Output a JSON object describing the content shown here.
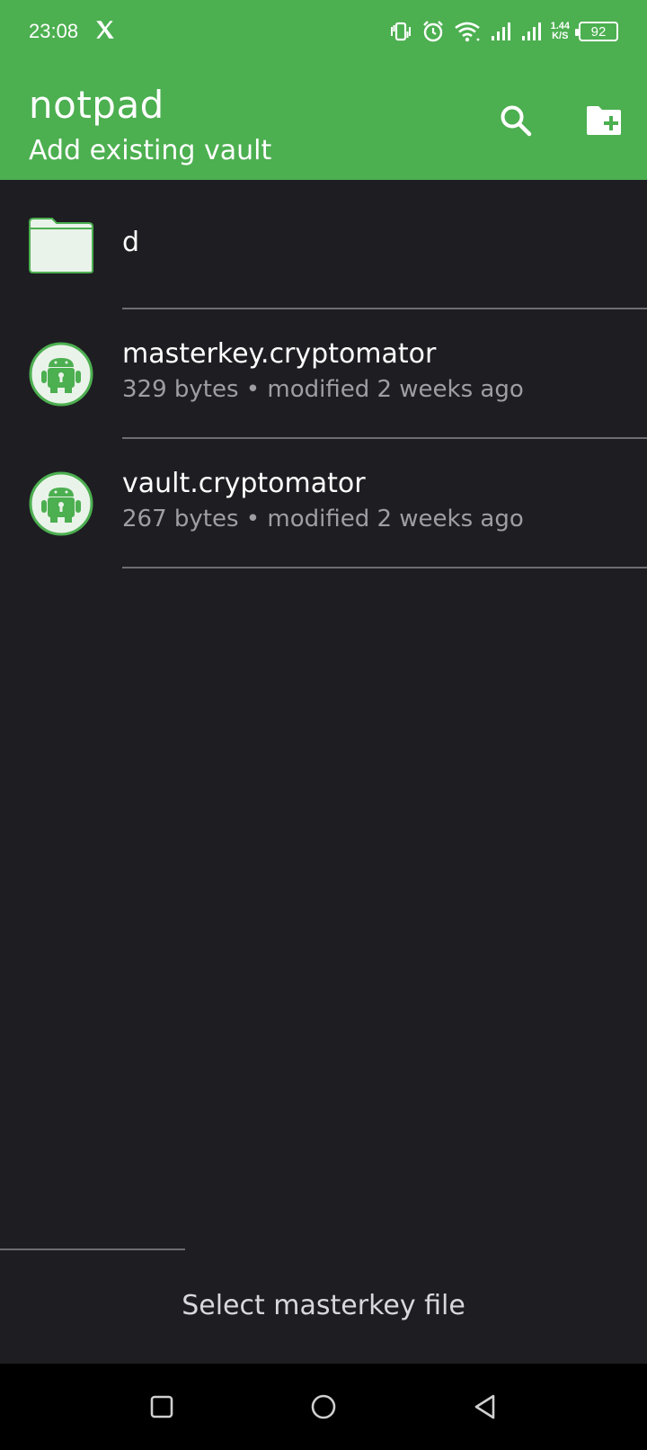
{
  "status_bar": {
    "time": "23:08",
    "net_speed_value": "1.44",
    "net_speed_unit": "K/S",
    "battery": "92",
    "icons": [
      "x-logo-icon",
      "vibrate-icon",
      "alarm-icon",
      "wifi-icon",
      "signal-icon",
      "signal-icon",
      "battery-icon"
    ]
  },
  "app_bar": {
    "title": "notpad",
    "subtitle": "Add existing vault",
    "actions": [
      "search-icon",
      "new-folder-icon"
    ],
    "background_color": "#4caf50"
  },
  "files": [
    {
      "type": "folder",
      "name": "d",
      "meta": ""
    },
    {
      "type": "file",
      "name": "masterkey.cryptomator",
      "meta": "329 bytes • modified 2 weeks ago"
    },
    {
      "type": "file",
      "name": "vault.cryptomator",
      "meta": "267 bytes • modified 2 weeks ago"
    }
  ],
  "bottom": {
    "select_label": "Select masterkey file"
  },
  "nav_bar": {
    "buttons": [
      "recents-icon",
      "home-icon",
      "back-icon"
    ]
  },
  "colors": {
    "background": "#1e1d22",
    "accent": "#4caf50",
    "secondary_text": "#9e9ea3"
  }
}
